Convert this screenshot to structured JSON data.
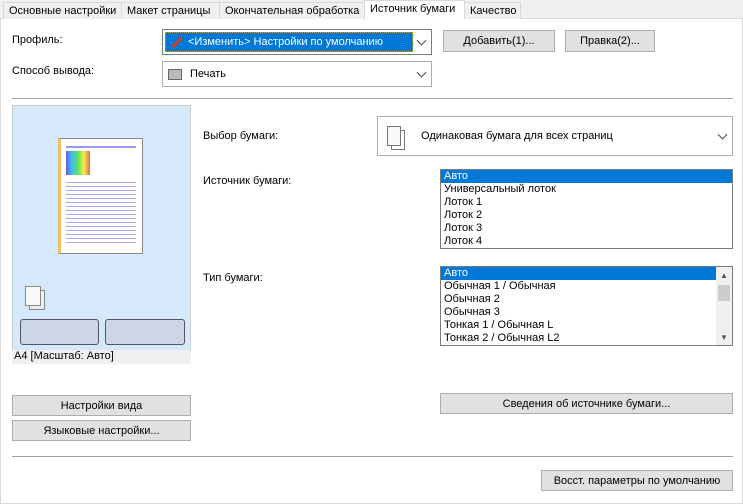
{
  "tabs": [
    {
      "label": "Основные настройки"
    },
    {
      "label": "Макет страницы"
    },
    {
      "label": "Окончательная обработка"
    },
    {
      "label": "Источник бумаги"
    },
    {
      "label": "Качество"
    }
  ],
  "profile": {
    "label": "Профиль:",
    "value": "<Изменить> Настройки по умолчанию",
    "add_button": "Добавить(1)...",
    "edit_button": "Правка(2)..."
  },
  "output": {
    "label": "Способ вывода:",
    "value": "Печать"
  },
  "preview": {
    "caption": "A4 [Масштаб: Авто]"
  },
  "left_buttons": {
    "view_settings": "Настройки вида",
    "language_settings": "Языковые настройки..."
  },
  "paper_selection": {
    "label": "Выбор бумаги:",
    "value": "Одинаковая бумага для всех страниц"
  },
  "paper_source": {
    "label": "Источник бумаги:",
    "items": [
      "Авто",
      "Универсальный лоток",
      "Лоток 1",
      "Лоток 2",
      "Лоток 3",
      "Лоток 4"
    ],
    "selected": 0
  },
  "paper_type": {
    "label": "Тип бумаги:",
    "items": [
      "Авто",
      "Обычная 1 / Обычная",
      "Обычная 2",
      "Обычная 3",
      "Тонкая 1 / Обычная L",
      "Тонкая 2 / Обычная L2"
    ],
    "selected": 0
  },
  "source_info_button": "Сведения об источнике бумаги...",
  "restore_defaults_button": "Восст. параметры по умолчанию",
  "colors": {
    "selection": "#0078d7",
    "preview_bg": "#d6e9fc"
  }
}
